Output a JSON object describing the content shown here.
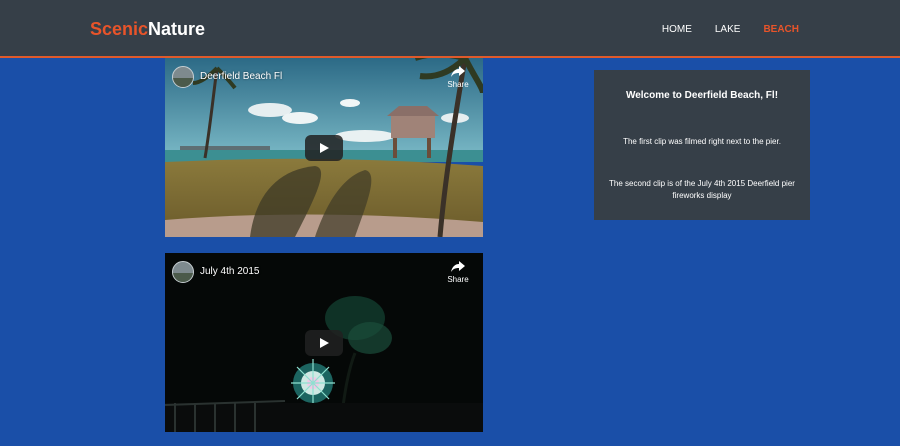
{
  "brand": {
    "accent": "Scenic",
    "rest": "Nature"
  },
  "nav": {
    "items": [
      "HOME",
      "LAKE",
      "BEACH"
    ],
    "active": "BEACH"
  },
  "videos": [
    {
      "title": "Deerfield Beach Fl",
      "share_label": "Share"
    },
    {
      "title": "July 4th 2015",
      "share_label": "Share"
    }
  ],
  "panel": {
    "heading": "Welcome to Deerfield Beach, Fl!",
    "paragraphs": [
      "The first clip was filmed right next to the pier.",
      "The second clip is of the July 4th 2015 Deerfield pier fireworks display"
    ]
  },
  "colors": {
    "accent": "#e8542a",
    "navbar": "#363f48",
    "background": "#1a4fa8",
    "panel": "#363f48"
  }
}
